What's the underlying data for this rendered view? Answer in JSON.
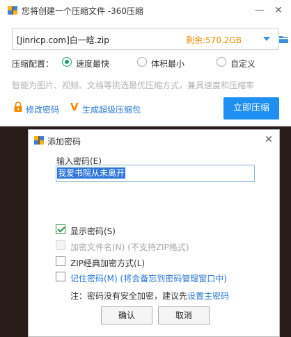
{
  "main_window": {
    "title": "您将创建一个压缩文件 -360压缩",
    "minimize_glyph": "—",
    "close_glyph": "✕",
    "archive_path": "[Jinricp.com]白一晗.zip",
    "remaining_space": "剩余:570.2GB",
    "config_label": "压缩配置：",
    "options": [
      {
        "label": "速度最快",
        "checked": true
      },
      {
        "label": "体积最小",
        "checked": false
      },
      {
        "label": "自定义",
        "checked": false
      }
    ],
    "hint": "智能为图片、视频、文档等挑选最优压缩方式，兼具速度和压缩率",
    "change_password_link": "修改密码",
    "super_package_link": "生成超级压缩包",
    "compress_button": "立即压缩",
    "icons": {
      "app": "app-archive-icon",
      "dropdown": "chevron-down-icon",
      "folder": "folder-icon",
      "lock": "lock-icon",
      "vip": "vip-v-icon"
    },
    "colors": {
      "accent": "#1e8ff3",
      "orange": "#f08a00",
      "green": "#1aa36e"
    }
  },
  "password_dialog": {
    "title": "添加密码",
    "close_glyph": "✕",
    "password_label": "输入密码(E)",
    "password_value": "我爱书院从未离开",
    "checkboxes": [
      {
        "label": "显示密码(S)",
        "checked": true,
        "disabled": false
      },
      {
        "label": "加密文件名(N) (不支持ZIP格式)",
        "checked": false,
        "disabled": true
      },
      {
        "label": "ZIP经典加密方式(L)",
        "checked": false,
        "disabled": false
      },
      {
        "label": "记住密码(M) (将会备忘到密码管理窗口中)",
        "checked": false,
        "disabled": false
      }
    ],
    "note_prefix": "注：密码没有安全加密，建议先",
    "note_link": "设置主密码",
    "ok_button": "确认",
    "cancel_button": "取消"
  }
}
